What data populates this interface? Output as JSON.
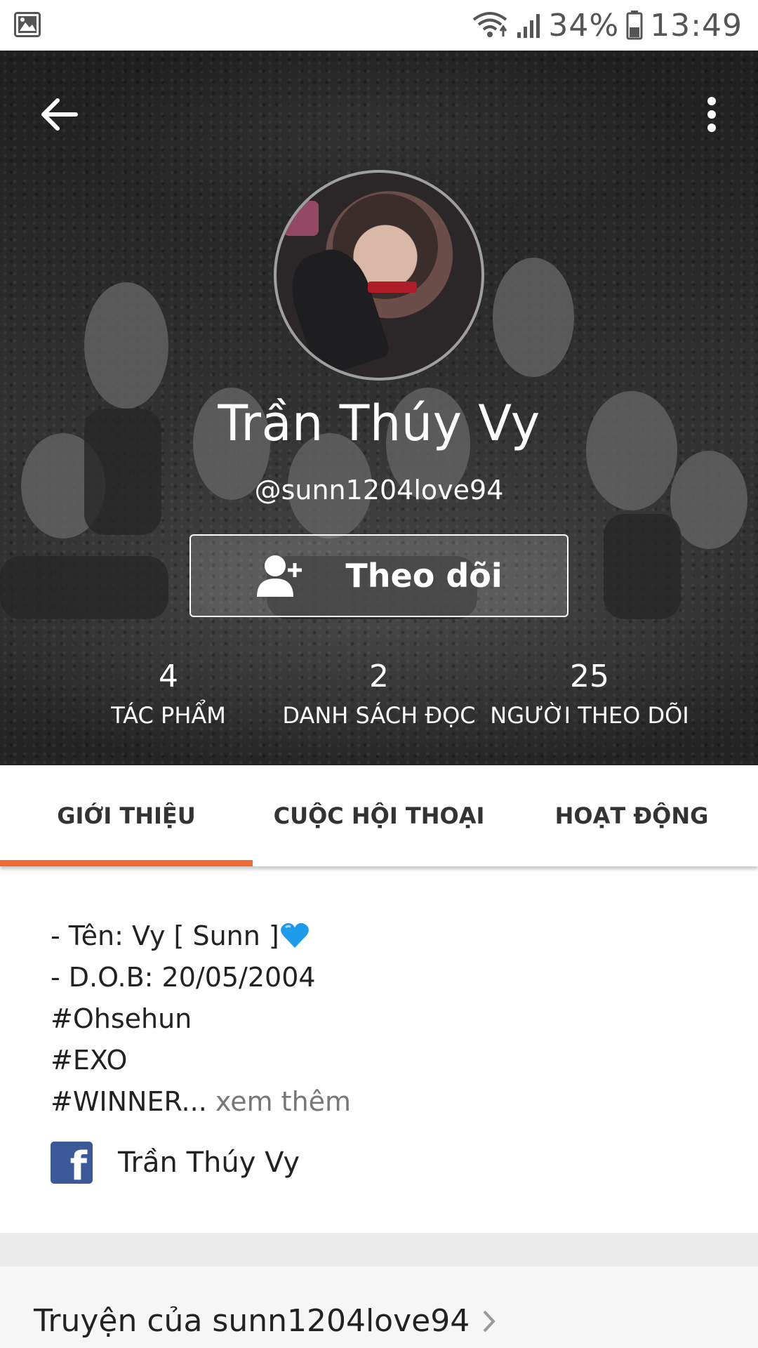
{
  "status_bar": {
    "battery": "34%",
    "time": "13:49",
    "icons": [
      "image-icon",
      "wifi-icon",
      "signal-icon",
      "battery-icon"
    ]
  },
  "header": {
    "back_icon": "arrow-left-icon",
    "menu_icon": "more-vertical-icon"
  },
  "profile": {
    "name": "Trần Thúy Vy",
    "handle": "@sunn1204love94",
    "follow_label": "Theo dõi",
    "follow_icon": "add-user-icon",
    "stats": [
      {
        "value": "4",
        "label": "TÁC PHẨM"
      },
      {
        "value": "2",
        "label": "DANH SÁCH ĐỌC"
      },
      {
        "value": "25",
        "label": "NGƯỜI THEO DÕI"
      }
    ]
  },
  "tabs": [
    {
      "label": "GIỚI THIỆU",
      "active": true
    },
    {
      "label": "CUỘC HỘI THOẠI",
      "active": false
    },
    {
      "label": "HOẠT ĐỘNG",
      "active": false
    }
  ],
  "accent_color": "#f26a31",
  "about": {
    "bio_lines": [
      "- Tên: Vy [ Sunn ]",
      "- D.O.B: 20/05/2004",
      "#Ohsehun",
      "#EXO",
      "#WINNER..."
    ],
    "see_more": "xem thêm",
    "facebook": {
      "icon": "facebook-icon",
      "name": "Trần Thúy Vy"
    }
  },
  "stories_section": {
    "title": "Truyện của sunn1204love94"
  }
}
